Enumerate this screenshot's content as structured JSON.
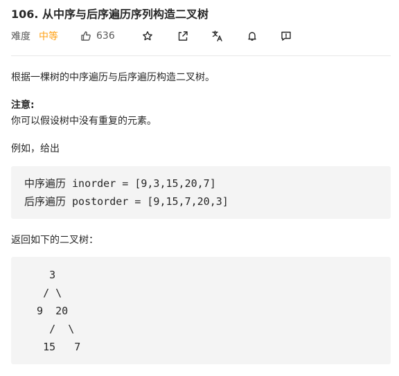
{
  "problem": {
    "title": "106. 从中序与后序遍历序列构造二叉树",
    "difficulty_label": "难度",
    "difficulty": "中等",
    "likes": "636"
  },
  "icons": {
    "like": "thumbs-up-icon",
    "star": "star-icon",
    "share": "share-icon",
    "translate": "translate-icon",
    "notify": "bell-icon",
    "feedback": "feedback-icon"
  },
  "colors": {
    "difficulty": "#ffa116",
    "code_bg": "#f4f4f4",
    "divider": "#e8e8e8"
  },
  "content": {
    "description": "根据一棵树的中序遍历与后序遍历构造二叉树。",
    "note_title": "注意:",
    "note_text": "你可以假设树中没有重复的元素。",
    "example_intro": "例如，给出",
    "example_code": "中序遍历 inorder = [9,3,15,20,7]\n后序遍历 postorder = [9,15,7,20,3]",
    "return_text": "返回如下的二叉树：",
    "tree_code": "    3\n   / \\\n  9  20\n    /  \\\n   15   7"
  }
}
